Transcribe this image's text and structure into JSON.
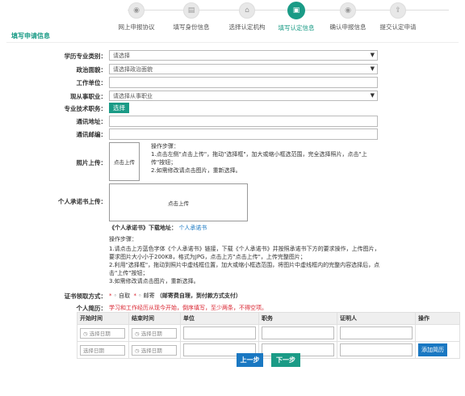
{
  "steps": [
    {
      "label": "网上申报协议",
      "icon": "eye-icon"
    },
    {
      "label": "填写身份信息",
      "icon": "document-icon"
    },
    {
      "label": "选择认定机构",
      "icon": "building-icon"
    },
    {
      "label": "填写认定信息",
      "icon": "form-icon",
      "active": true
    },
    {
      "label": "确认申报信息",
      "icon": "eye-icon"
    },
    {
      "label": "提交认定申请",
      "icon": "submit-icon"
    }
  ],
  "section_title": "填写申请信息",
  "form": {
    "edu_category_label": "学历专业类别：",
    "edu_category_value": "请选择",
    "political_label": "政治面貌：",
    "political_value": "请选择政治面貌",
    "work_unit_label": "工作单位：",
    "current_job_label": "现从事职业：",
    "current_job_value": "请选择从事职业",
    "tech_title_label": "专业技术职务：",
    "tech_title_button": "选择",
    "address_label": "通讯地址：",
    "postcode_label": "通讯邮编：",
    "photo_label": "照片上传：",
    "photo_box_text": "点击上传",
    "photo_steps_title": "操作步骤：",
    "photo_step1": "1.点击左侧\"点击上传\"，拖动\"选择框\"，加大或缩小框选范围，完全选择照片，点击\"上传\"按钮；",
    "photo_step2": "2.如需修改请点击图片，重新选择。",
    "pledge_label": "个人承诺书上传：",
    "pledge_box_text": "点击上传",
    "pledge_download_label": "《个人承诺书》下载地址：",
    "pledge_download_link": "个人承诺书",
    "pledge_steps_title": "操作步骤：",
    "pledge_step1": "1.请点击上方蓝色字体《个人承诺书》链接，下载《个人承诺书》并按照承诺书下方的要求操作，上传图片，要求图片大小小于200KB，格式为JPG，点击上方\"点击上传\"，上传完整图片；",
    "pledge_step2": "2.利用\"选择框\"，拖动到照片中虚线框位置，加大或缩小框选范围，将图片中虚线框内的完整内容选择后，点击\"上传\"按钮；",
    "pledge_step3": "3.如需修改请点击图片，重新选择。",
    "cert_method_label": "证书领取方式：",
    "cert_opt1": "自取",
    "cert_opt2": "邮寄",
    "cert_note": "（邮寄费自理，到付款方式支付）",
    "resume_label": "个人简历：",
    "resume_hint": "学习和工作经历从现今开始，倒序填写，至少两条，不得空项。"
  },
  "history": {
    "headers": [
      "开始时间",
      "结束时间",
      "单位",
      "职务",
      "证明人",
      "操作"
    ],
    "date_placeholder": "选择日期",
    "add_button": "添加简历"
  },
  "nav": {
    "prev": "上一步",
    "next": "下一步"
  },
  "colors": {
    "accent": "#1a9b86",
    "link": "#1a78c2",
    "warning": "#d9232f"
  }
}
